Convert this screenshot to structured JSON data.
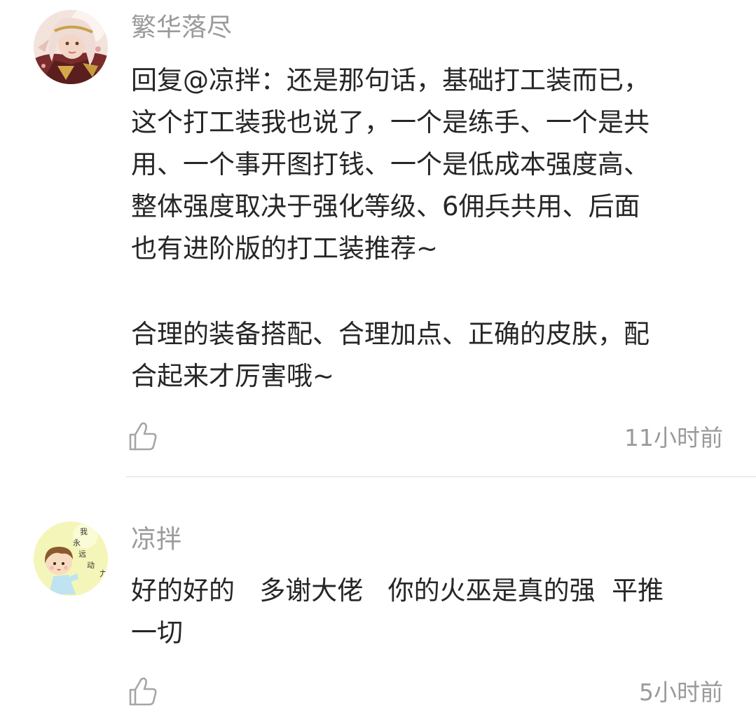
{
  "comments": [
    {
      "username": "繁华落尽",
      "paragraphs": [
        [
          "回复@凉拌：还是那句话，基础打工装而已，",
          "这个打工装我也说了，一个是练手、一个是共",
          "用、一个事开图打钱、一个是低成本强度高、",
          "整体强度取决于强化等级、6佣兵共用、后面",
          "也有进阶版的打工装推荐~"
        ],
        [
          "合理的装备搭配、合理加点、正确的皮肤，配",
          "合起来才厉害哦~"
        ]
      ],
      "time": "11小时前",
      "like_icon": "thumbs-up-icon"
    },
    {
      "username": "凉拌",
      "paragraphs": [
        [
          "好的好的   多谢大佬   你的火巫是真的强  平推",
          "一切"
        ]
      ],
      "avatar_text": [
        "我",
        "永",
        "远",
        "动",
        "力"
      ],
      "time": "5小时前",
      "like_icon": "thumbs-up-icon"
    }
  ],
  "colors": {
    "username": "#9a9a9a",
    "body_text": "#262626",
    "time": "#9a9a9a",
    "divider": "#ececec",
    "icon": "#a6a6a6"
  }
}
